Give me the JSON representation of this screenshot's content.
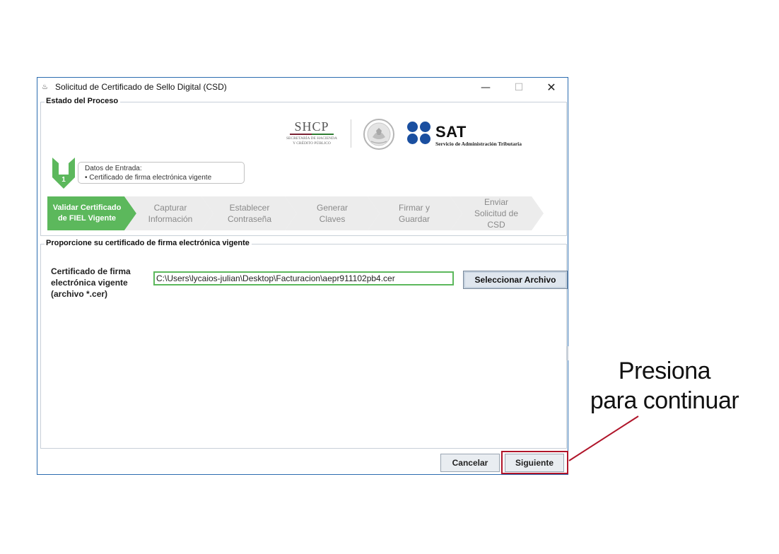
{
  "window": {
    "title": "Solicitud de Certificado de Sello Digital (CSD)",
    "controls": {
      "minimize": "—",
      "maximize": "☐",
      "close": "✕"
    }
  },
  "process": {
    "section_title": "Estado del Proceso",
    "logos": {
      "shcp_word": "SHCP",
      "shcp_sub": "SECRETARÍA DE HACIENDA\nY CRÉDITO PÚBLICO",
      "sat_word": "SAT",
      "sat_sub": "Servicio de Administración Tributaria"
    },
    "current_step": {
      "number": "1",
      "title": "Datos de Entrada:",
      "item": "•   Certificado de firma electrónica vigente"
    },
    "steps": [
      {
        "label": "Validar Certificado\nde FIEL Vigente",
        "active": true
      },
      {
        "label": "Capturar\nInformación",
        "active": false
      },
      {
        "label": "Establecer\nContraseña",
        "active": false
      },
      {
        "label": "Generar\nClaves",
        "active": false
      },
      {
        "label": "Firmar y\nGuardar",
        "active": false
      },
      {
        "label": "Enviar\nSolicitud de\nCSD",
        "active": false
      }
    ],
    "colors": {
      "active": "#5cb85c",
      "inactive": "#ececec"
    }
  },
  "certificate": {
    "section_title": "Proporcione su certificado de firma electrónica vigente",
    "field_label": "Certificado de firma\nelectrónica vigente\n(archivo *.cer)",
    "path_value": "C:\\Users\\lycaios-julian\\Desktop\\Facturacion\\aepr911102pb4.cer",
    "select_button": "Seleccionar Archivo"
  },
  "footer": {
    "cancel_button": "Cancelar",
    "next_button": "Siguiente"
  },
  "annotation": {
    "text": "Presiona\npara continuar",
    "color": "#b0152a"
  }
}
